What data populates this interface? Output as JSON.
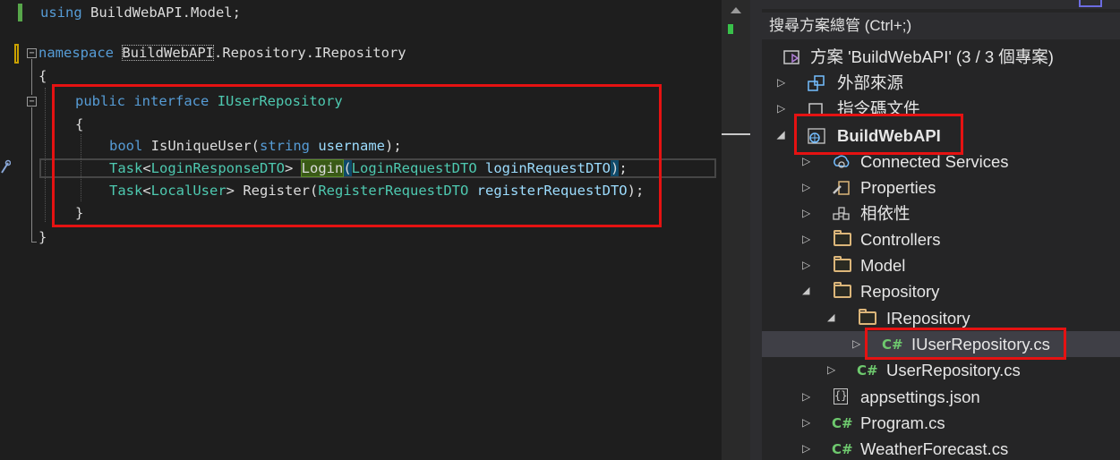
{
  "editor": {
    "using_kw": "using",
    "using_ns": " BuildWebAPI.Model;",
    "ns_kw": "namespace",
    "ns_name_a": "BuildWebAPI",
    "ns_name_b": ".Repository.IRepository",
    "open_brace": "{",
    "close_brace": "}",
    "iface_public": "public",
    "iface_interface": "interface",
    "iface_name": "IUserRepository",
    "m1_bool": "bool",
    "m1_name": "IsUniqueUser(",
    "m1_string": "string",
    "m1_param": "username",
    "m1_end": ");",
    "m2_task": "Task",
    "m2_lt": "<",
    "m2_type": "LoginResponseDTO",
    "m2_gt": "> ",
    "m2_name": "Login",
    "m2_paren_open": "(",
    "m2_ptype": "LoginRequestDTO",
    "m2_param": " loginRequestDTO",
    "m2_paren_close": ")",
    "m2_end": ";",
    "m3_task": "Task",
    "m3_lt": "<",
    "m3_type": "LocalUser",
    "m3_gt": "> ",
    "m3_name": "Register(",
    "m3_ptype": "RegisterRequestDTO",
    "m3_param": " registerRequestDTO",
    "m3_end": ");",
    "fold_symbol": "−"
  },
  "solution_explorer": {
    "search_placeholder": "搜尋方案總管 (Ctrl+;)",
    "items": [
      {
        "label": "方案 'BuildWebAPI' (3 / 3 個專案)",
        "icon": "solution-icon"
      },
      {
        "label": "外部來源",
        "icon": "external-sources-icon"
      },
      {
        "label": "指令碼文件",
        "icon": "script-documents-icon"
      },
      {
        "label": "BuildWebAPI",
        "icon": "web-project-icon"
      },
      {
        "label": "Connected Services",
        "icon": "connected-services-icon"
      },
      {
        "label": "Properties",
        "icon": "properties-icon"
      },
      {
        "label": "相依性",
        "icon": "dependencies-icon"
      },
      {
        "label": "Controllers",
        "icon": "folder-icon"
      },
      {
        "label": "Model",
        "icon": "folder-icon"
      },
      {
        "label": "Repository",
        "icon": "folder-icon"
      },
      {
        "label": "IRepository",
        "icon": "folder-icon"
      },
      {
        "label": "IUserRepository.cs",
        "icon": "csharp-file-icon"
      },
      {
        "label": "UserRepository.cs",
        "icon": "csharp-file-icon"
      },
      {
        "label": "appsettings.json",
        "icon": "json-file-icon"
      },
      {
        "label": "Program.cs",
        "icon": "csharp-file-icon"
      },
      {
        "label": "WeatherForecast.cs",
        "icon": "csharp-file-icon"
      }
    ],
    "cs_glyph": "C#",
    "json_glyph": "{}",
    "arrow_expanded": "◢",
    "arrow_collapsed": "▷"
  }
}
